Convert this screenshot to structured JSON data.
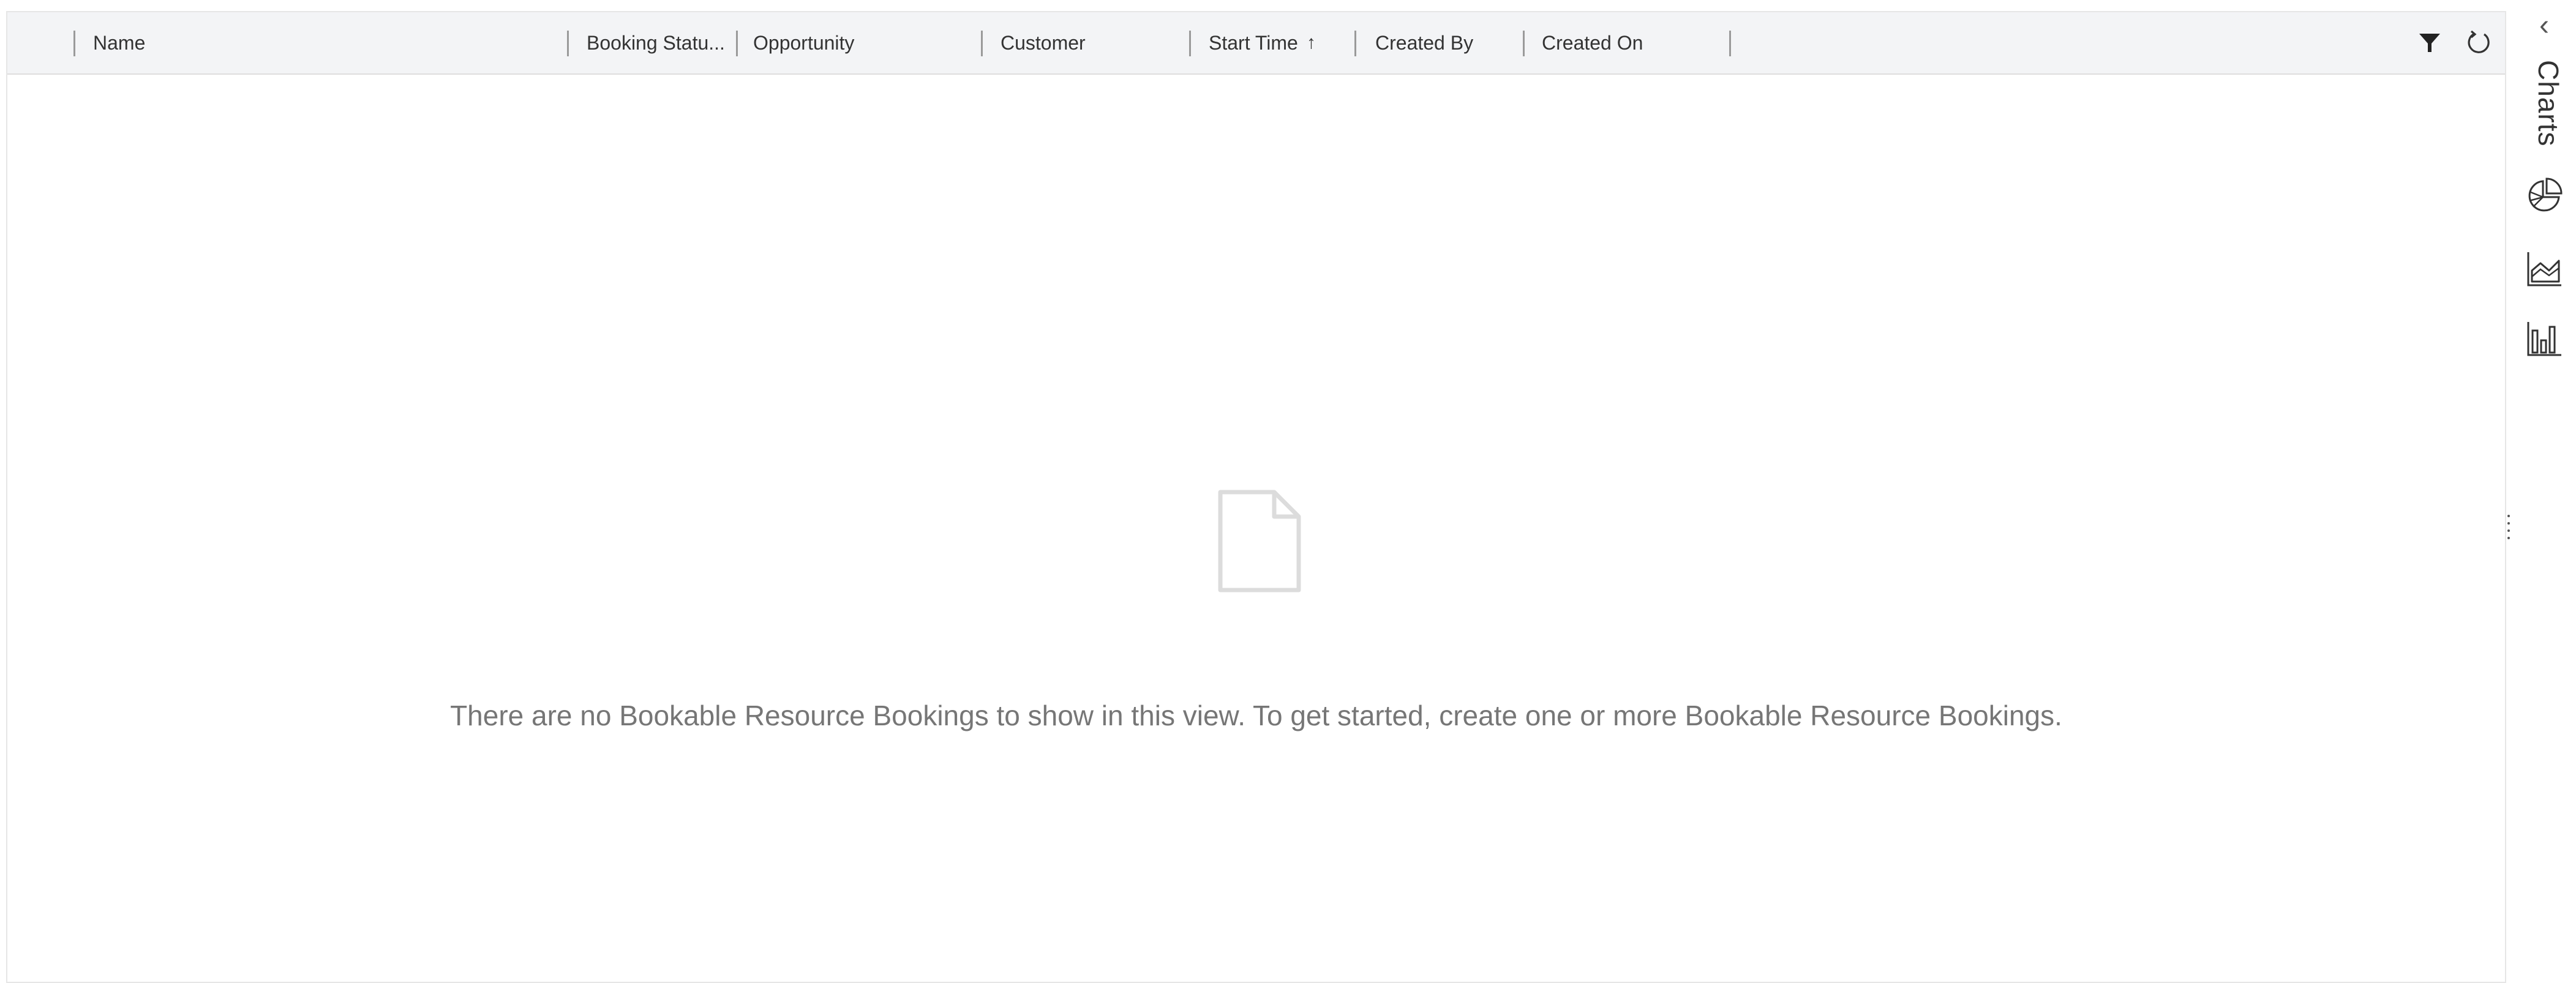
{
  "grid": {
    "columns": [
      {
        "label": "Name"
      },
      {
        "label": "Booking Statu..."
      },
      {
        "label": "Opportunity"
      },
      {
        "label": "Customer"
      },
      {
        "label": "Start Time",
        "sort": "ascending",
        "sort_glyph": "↑"
      },
      {
        "label": "Created By"
      },
      {
        "label": "Created On"
      }
    ],
    "toolbar_icons": [
      "filter-icon",
      "refresh-icon"
    ],
    "empty_message": "There are no Bookable Resource Bookings to show in this view. To get started, create one or more Bookable Resource Bookings."
  },
  "side_panel": {
    "collapse_glyph": "‹",
    "title": "Charts",
    "icons": [
      "pie-chart-icon",
      "area-chart-icon",
      "bar-chart-icon"
    ]
  },
  "colors": {
    "header_bg": "#f3f4f6",
    "border": "#e6e6e6",
    "text": "#333333",
    "muted_text": "#767676",
    "icon_gray": "#dcdcdc"
  }
}
